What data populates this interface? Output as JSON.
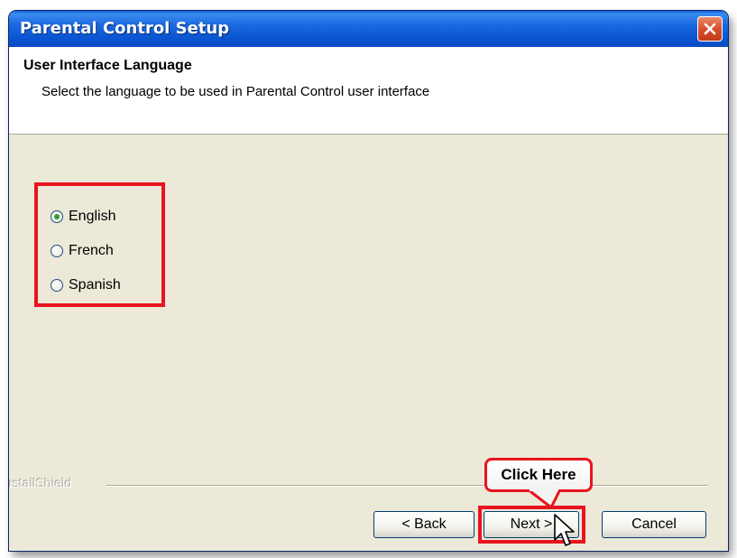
{
  "window": {
    "title": "Parental Control Setup"
  },
  "header": {
    "title": "User Interface Language",
    "subtitle": "Select the language to be used in Parental Control user interface"
  },
  "languages": {
    "options": [
      {
        "label": "English",
        "checked": true
      },
      {
        "label": "French",
        "checked": false
      },
      {
        "label": "Spanish",
        "checked": false
      }
    ]
  },
  "footer": {
    "brand": "ıstallShield",
    "back_label": "< Back",
    "next_label": "Next >",
    "cancel_label": "Cancel"
  },
  "annotation": {
    "callout_text": "Click Here",
    "highlight_color": "#e8141e"
  },
  "icons": {
    "close": "close-icon",
    "cursor": "mouse-pointer-icon"
  }
}
